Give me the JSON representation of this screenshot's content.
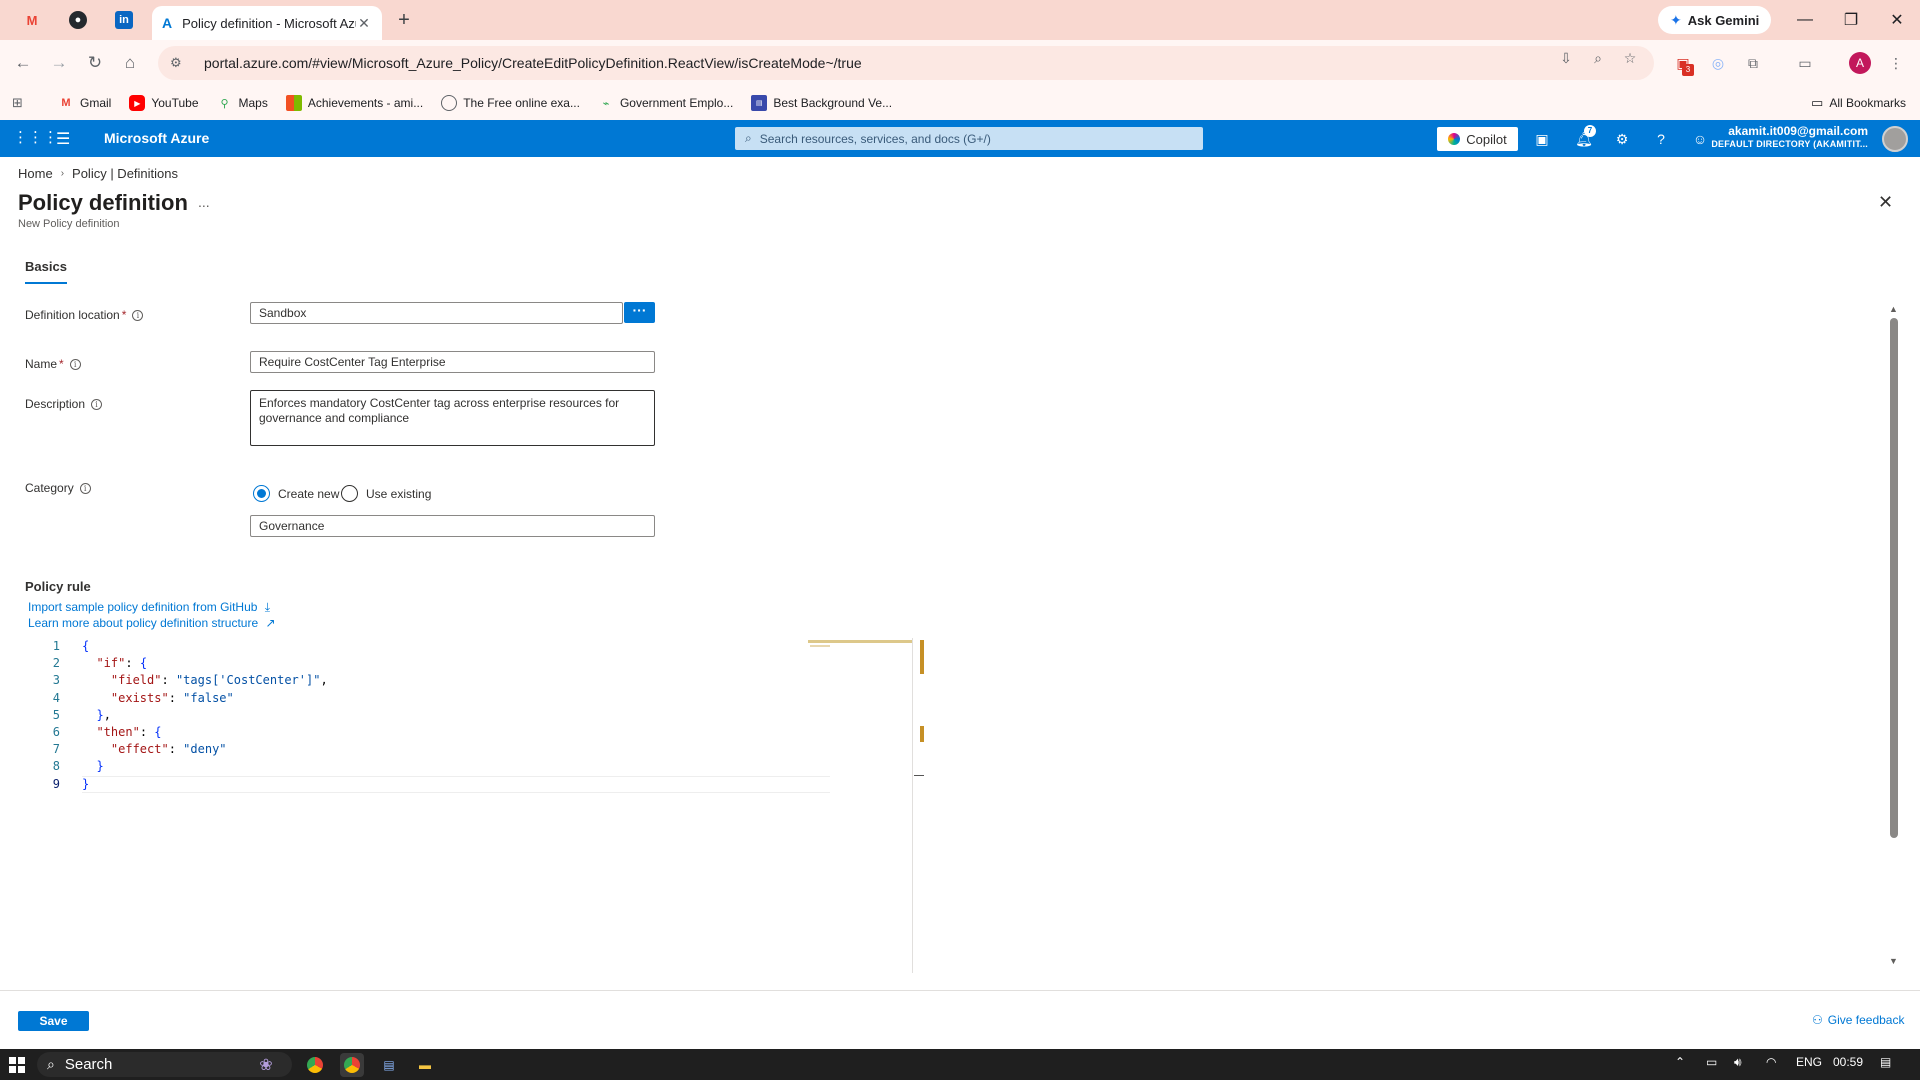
{
  "browser": {
    "active_tab_title": "Policy definition - Microsoft Azure",
    "tab_close": "✕",
    "new_tab": "+",
    "ask_gemini": "Ask Gemini",
    "url": "portal.azure.com/#view/Microsoft_Azure_Policy/CreateEditPolicyDefinition.ReactView/isCreateMode~/true",
    "extension_badge": "3",
    "profile_initial": "A",
    "bookmarks": [
      "Gmail",
      "YouTube",
      "Maps",
      "Achievements - ami...",
      "The Free online exa...",
      "Government Emplo...",
      "Best Background Ve..."
    ],
    "all_bookmarks": "All Bookmarks"
  },
  "azure": {
    "brand": "Microsoft Azure",
    "search_placeholder": "Search resources, services, and docs (G+/)",
    "copilot": "Copilot",
    "notification_count": "7",
    "user_email": "akamit.it009@gmail.com",
    "directory": "DEFAULT DIRECTORY (AKAMITIT..."
  },
  "page": {
    "breadcrumb": [
      "Home",
      "Policy | Definitions"
    ],
    "title": "Policy definition",
    "more": "...",
    "subtitle": "New Policy definition",
    "tab": "Basics"
  },
  "form": {
    "definition_location_label": "Definition location",
    "definition_location_value": "Sandbox",
    "browse_button": "···",
    "name_label": "Name",
    "name_value": "Require CostCenter Tag Enterprise",
    "description_label": "Description",
    "description_value": "Enforces mandatory CostCenter tag across enterprise resources for governance and compliance",
    "category_label": "Category",
    "radio_create_new": "Create new",
    "radio_use_existing": "Use existing",
    "category_value": "Governance",
    "required_mark": "*"
  },
  "policy_rule": {
    "label": "Policy rule",
    "import_link": "Import sample policy definition from GitHub",
    "learn_link": "Learn more about policy definition structure",
    "lines": [
      {
        "n": "1",
        "text": "{"
      },
      {
        "n": "2",
        "text": "  \"if\": {"
      },
      {
        "n": "3",
        "text": "    \"field\": \"tags['CostCenter']\","
      },
      {
        "n": "4",
        "text": "    \"exists\": \"false\""
      },
      {
        "n": "5",
        "text": "  },"
      },
      {
        "n": "6",
        "text": "  \"then\": {"
      },
      {
        "n": "7",
        "text": "    \"effect\": \"deny\""
      },
      {
        "n": "8",
        "text": "  }"
      },
      {
        "n": "9",
        "text": "}"
      }
    ]
  },
  "footer": {
    "save": "Save",
    "feedback": "Give feedback"
  },
  "taskbar": {
    "search": "Search",
    "lang": "ENG",
    "time": "00:59"
  }
}
